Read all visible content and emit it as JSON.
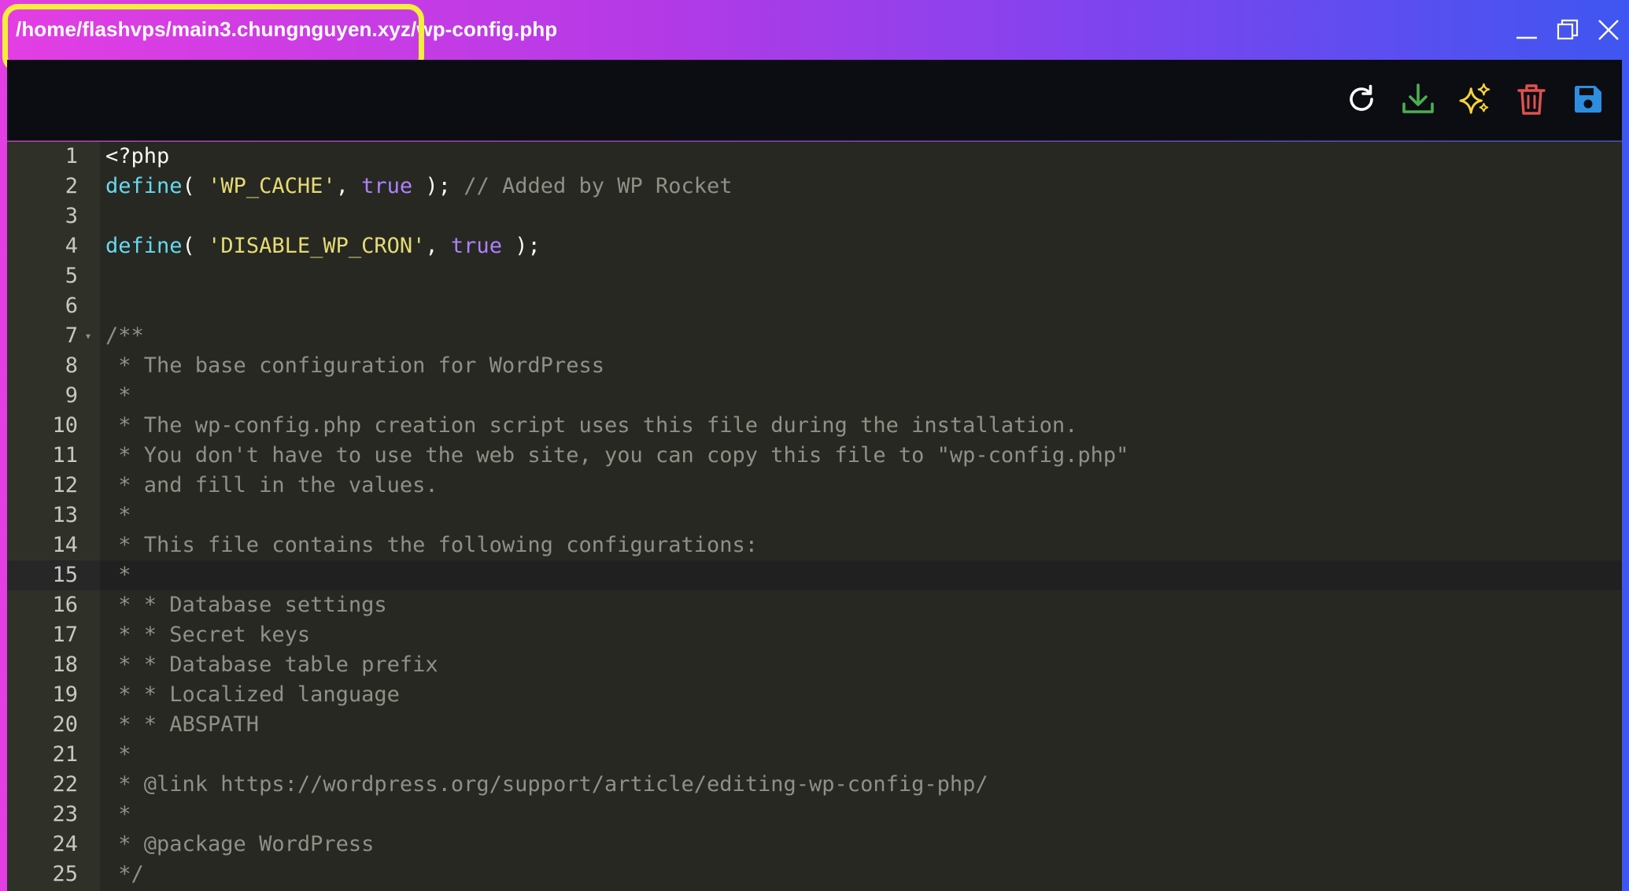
{
  "window": {
    "title": "/home/flashvps/main3.chungnguyen.xyz/wp-config.php",
    "controls": [
      "minimize",
      "maximize",
      "close"
    ]
  },
  "toolbar": {
    "buttons": [
      {
        "name": "reload",
        "icon": "refresh-icon",
        "color": "#ffffff"
      },
      {
        "name": "download",
        "icon": "download-icon",
        "color": "#4caf50"
      },
      {
        "name": "ai-format",
        "icon": "sparkles-icon",
        "color": "#f5d33a"
      },
      {
        "name": "delete",
        "icon": "trash-icon",
        "color": "#e0514f"
      },
      {
        "name": "save",
        "icon": "floppy-disk-icon",
        "color": "#2d8ee0"
      }
    ]
  },
  "colors": {
    "gradient_start": "#e33ee3",
    "gradient_end": "#3f56f0",
    "highlight_ring": "#f3ef3a",
    "editor_bg": "#272822",
    "keyword_fn": "#66d9ef",
    "string": "#e6db74",
    "constant": "#ae81ff",
    "comment": "#909086"
  },
  "editor": {
    "active_line": 15,
    "lines": [
      {
        "n": "1",
        "tokens": [
          {
            "t": "plain",
            "v": "<?php"
          }
        ]
      },
      {
        "n": "2",
        "tokens": [
          {
            "t": "fn",
            "v": "define"
          },
          {
            "t": "plain",
            "v": "( "
          },
          {
            "t": "str",
            "v": "'WP_CACHE'"
          },
          {
            "t": "plain",
            "v": ", "
          },
          {
            "t": "const",
            "v": "true"
          },
          {
            "t": "plain",
            "v": " ); "
          },
          {
            "t": "cmt",
            "v": "// Added by WP Rocket"
          }
        ]
      },
      {
        "n": "3",
        "tokens": []
      },
      {
        "n": "4",
        "tokens": [
          {
            "t": "fn",
            "v": "define"
          },
          {
            "t": "plain",
            "v": "( "
          },
          {
            "t": "str",
            "v": "'DISABLE_WP_CRON'"
          },
          {
            "t": "plain",
            "v": ", "
          },
          {
            "t": "const",
            "v": "true"
          },
          {
            "t": "plain",
            "v": " );"
          }
        ]
      },
      {
        "n": "5",
        "tokens": []
      },
      {
        "n": "6",
        "tokens": []
      },
      {
        "n": "7",
        "fold": true,
        "tokens": [
          {
            "t": "cmt",
            "v": "/**"
          }
        ]
      },
      {
        "n": "8",
        "tokens": [
          {
            "t": "cmt",
            "v": " * The base configuration for WordPress"
          }
        ]
      },
      {
        "n": "9",
        "tokens": [
          {
            "t": "cmt",
            "v": " *"
          }
        ]
      },
      {
        "n": "10",
        "tokens": [
          {
            "t": "cmt",
            "v": " * The wp-config.php creation script uses this file during the installation."
          }
        ]
      },
      {
        "n": "11",
        "tokens": [
          {
            "t": "cmt",
            "v": " * You don't have to use the web site, you can copy this file to \"wp-config.php\""
          }
        ]
      },
      {
        "n": "12",
        "tokens": [
          {
            "t": "cmt",
            "v": " * and fill in the values."
          }
        ]
      },
      {
        "n": "13",
        "tokens": [
          {
            "t": "cmt",
            "v": " *"
          }
        ]
      },
      {
        "n": "14",
        "tokens": [
          {
            "t": "cmt",
            "v": " * This file contains the following configurations:"
          }
        ]
      },
      {
        "n": "15",
        "tokens": [
          {
            "t": "cmt",
            "v": " *"
          }
        ]
      },
      {
        "n": "16",
        "tokens": [
          {
            "t": "cmt",
            "v": " * * Database settings"
          }
        ]
      },
      {
        "n": "17",
        "tokens": [
          {
            "t": "cmt",
            "v": " * * Secret keys"
          }
        ]
      },
      {
        "n": "18",
        "tokens": [
          {
            "t": "cmt",
            "v": " * * Database table prefix"
          }
        ]
      },
      {
        "n": "19",
        "tokens": [
          {
            "t": "cmt",
            "v": " * * Localized language"
          }
        ]
      },
      {
        "n": "20",
        "tokens": [
          {
            "t": "cmt",
            "v": " * * ABSPATH"
          }
        ]
      },
      {
        "n": "21",
        "tokens": [
          {
            "t": "cmt",
            "v": " *"
          }
        ]
      },
      {
        "n": "22",
        "tokens": [
          {
            "t": "cmt",
            "v": " * @link https://wordpress.org/support/article/editing-wp-config-php/"
          }
        ]
      },
      {
        "n": "23",
        "tokens": [
          {
            "t": "cmt",
            "v": " *"
          }
        ]
      },
      {
        "n": "24",
        "tokens": [
          {
            "t": "cmt",
            "v": " * @package WordPress"
          }
        ]
      },
      {
        "n": "25",
        "tokens": [
          {
            "t": "cmt",
            "v": " */"
          }
        ]
      }
    ]
  }
}
